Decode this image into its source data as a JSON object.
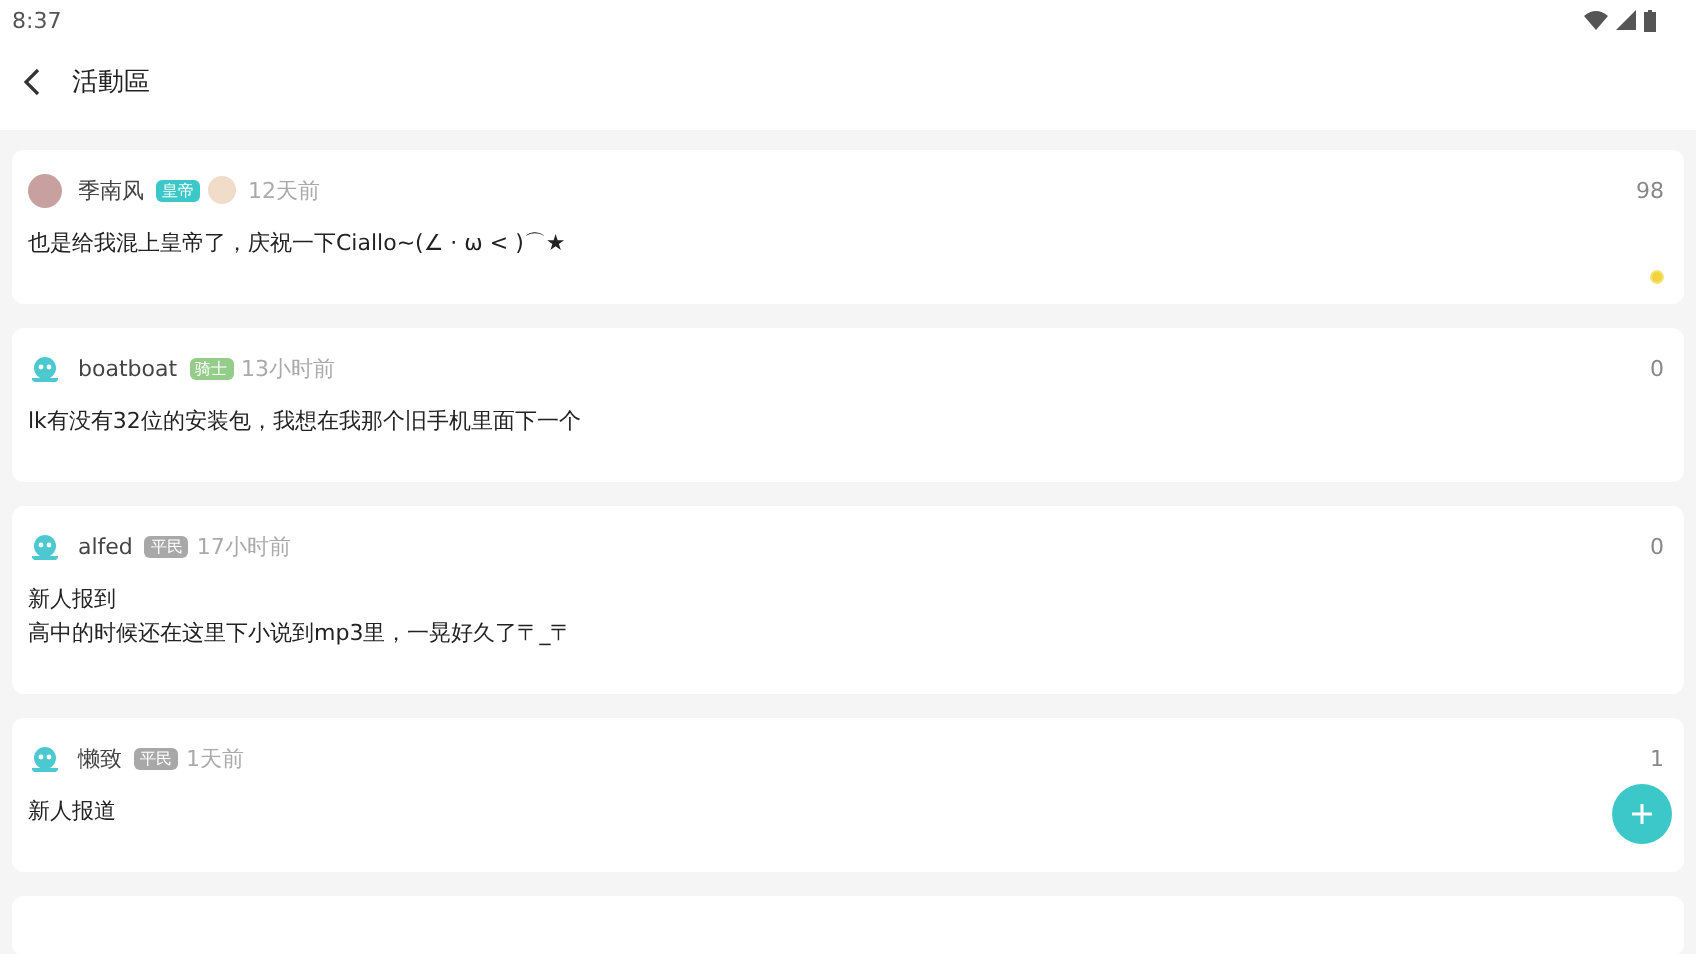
{
  "status_bar": {
    "time": "8:37"
  },
  "header": {
    "title": "活動區"
  },
  "posts": [
    {
      "author": "季南风",
      "custom_avatar": true,
      "badge": {
        "label": "皇帝",
        "color": "#3cc8c8"
      },
      "decoration": true,
      "time": "12天前",
      "count": "98",
      "lines": [
        "也是给我混上皇帝了，庆祝一下Ciallo~(∠ · ω < )⌒★"
      ],
      "marked": true
    },
    {
      "author": "boatboat",
      "custom_avatar": false,
      "badge": {
        "label": "骑士",
        "color": "#94cc8a"
      },
      "decoration": false,
      "time": "13小时前",
      "count": "0",
      "lines": [
        "lk有没有32位的安装包，我想在我那个旧手机里面下一个"
      ],
      "marked": false
    },
    {
      "author": "alfed",
      "custom_avatar": false,
      "badge": {
        "label": "平民",
        "color": "#a8a8a8"
      },
      "decoration": false,
      "time": "17小时前",
      "count": "0",
      "lines": [
        "新人报到",
        "高中的时候还在这里下小说到mp3里，一晃好久了〒_〒"
      ],
      "marked": false
    },
    {
      "author": "懒致",
      "custom_avatar": false,
      "badge": {
        "label": "平民",
        "color": "#a8a8a8"
      },
      "decoration": false,
      "time": "1天前",
      "count": "1",
      "lines": [
        "新人报道"
      ],
      "marked": false
    }
  ],
  "more_posts_below": true
}
